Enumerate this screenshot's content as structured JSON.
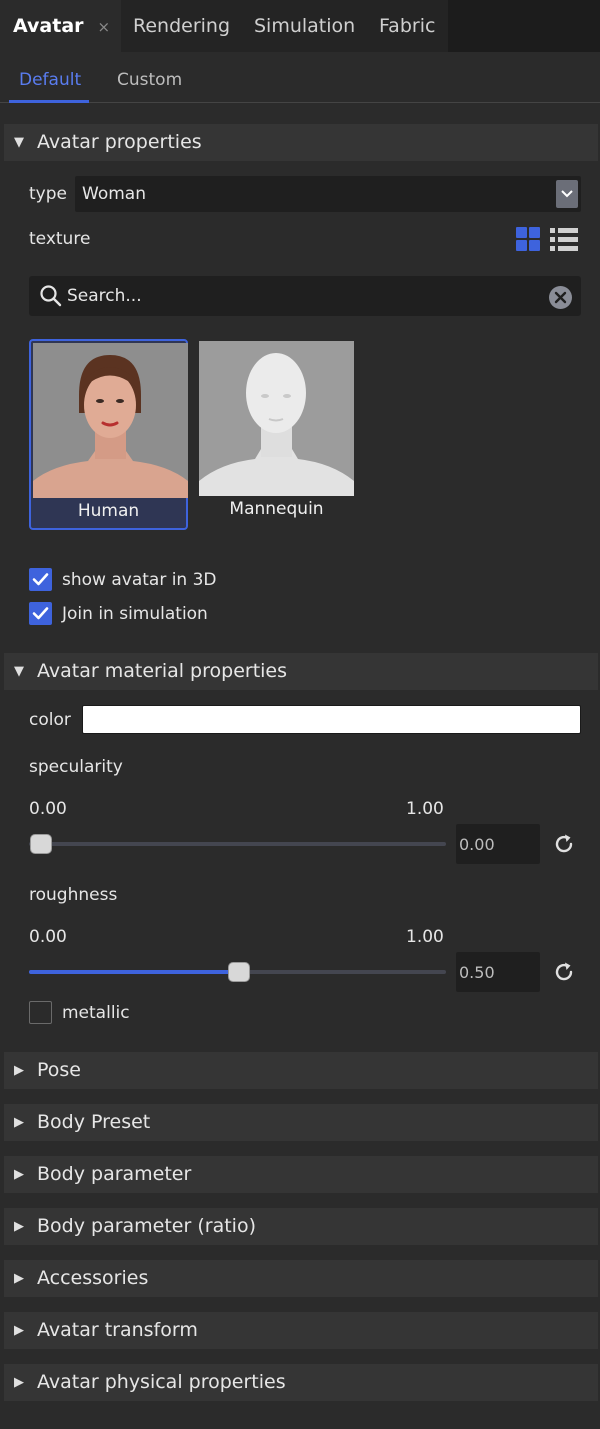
{
  "top_tabs": [
    {
      "label": "Avatar",
      "close": "×"
    },
    {
      "label": "Rendering"
    },
    {
      "label": "Simulation"
    },
    {
      "label": "Fabric"
    }
  ],
  "sub_tabs": [
    "Default",
    "Custom"
  ],
  "avatar_properties": {
    "title": "Avatar properties",
    "type_label": "type",
    "type_value": "Woman",
    "texture_label": "texture",
    "search_placeholder": "Search...",
    "cards": [
      {
        "label": "Human",
        "selected": true
      },
      {
        "label": "Mannequin",
        "selected": false
      }
    ],
    "checkboxes": [
      {
        "label": "show avatar in 3D",
        "checked": true
      },
      {
        "label": "Join in simulation",
        "checked": true
      }
    ]
  },
  "material": {
    "title": "Avatar material properties",
    "color_label": "color",
    "color_value": "#ffffff",
    "specularity": {
      "label": "specularity",
      "min": "0.00",
      "max": "1.00",
      "value": "0.00",
      "fraction": 0.0
    },
    "roughness": {
      "label": "roughness",
      "min": "0.00",
      "max": "1.00",
      "value": "0.50",
      "fraction": 0.5
    },
    "metallic": {
      "label": "metallic",
      "checked": false
    }
  },
  "collapsed_sections": [
    "Pose",
    "Body Preset",
    "Body parameter",
    "Body parameter (ratio)",
    "Accessories",
    "Avatar transform",
    "Avatar physical properties"
  ],
  "colors": {
    "accent": "#3e63dd",
    "background": "#2b2b2b",
    "field": "#1f1f1f",
    "section": "#353535"
  }
}
